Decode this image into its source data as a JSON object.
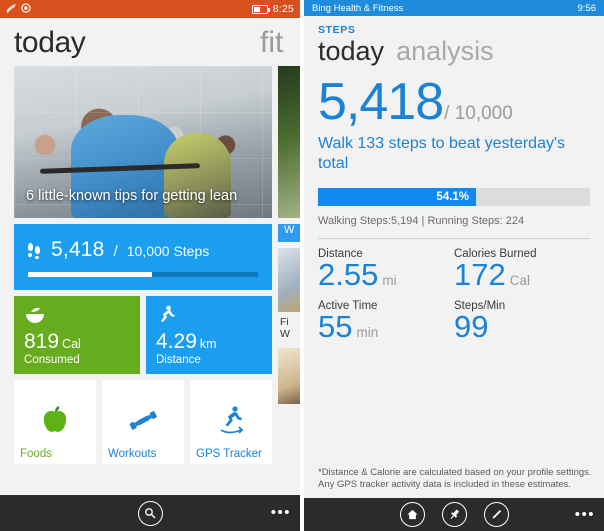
{
  "left_phone": {
    "status_bar": {
      "signal_icon": "wifi-icon",
      "record_icon": "record-icon",
      "battery_icon": "battery-icon",
      "time": "8:25",
      "background_color": "#d9501f"
    },
    "pivot": {
      "current": "today",
      "next": "fit"
    },
    "hero_tile": {
      "caption": "6 little-known tips for getting lean"
    },
    "steps_tile": {
      "icon": "footsteps-icon",
      "value": "5,418",
      "separator": "/",
      "goal": "10,000 Steps",
      "progress_percent": 54.1,
      "background_color": "#1b9df0"
    },
    "metric_tiles": [
      {
        "icon": "food-bowl-icon",
        "value": "819",
        "unit": "Cal",
        "label": "Consumed",
        "color": "#67ab1e"
      },
      {
        "icon": "runner-icon",
        "value": "4.29",
        "unit": "km",
        "label": "Distance",
        "color": "#1b9df0"
      }
    ],
    "quick_tiles": [
      {
        "icon": "apple-icon",
        "label": "Foods",
        "color": "#67ab1e"
      },
      {
        "icon": "dumbbell-icon",
        "label": "Workouts",
        "color": "#1b82d4"
      },
      {
        "icon": "gps-runner-icon",
        "label": "GPS Tracker",
        "color": "#1b82d4"
      }
    ],
    "side_column": {
      "badge": "W",
      "caption_line1": "Fi",
      "caption_line2": "W"
    },
    "app_bar": {
      "search_icon": "search-icon",
      "more_icon": "ellipsis-icon"
    }
  },
  "right_phone": {
    "status_bar": {
      "app_title": "Bing Health & Fitness",
      "time": "9:56",
      "background_color": "#1f8bdb"
    },
    "kicker": "STEPS",
    "pivot": {
      "current": "today",
      "next": "analysis"
    },
    "hero": {
      "steps": "5,418",
      "goal": "/ 10,000",
      "message": "Walk 133 steps to beat yesterday's total"
    },
    "progress": {
      "label": "54.1%",
      "percent": 54.1,
      "fill_color": "#1289f0",
      "track_color": "#dcdcdc"
    },
    "split": "Walking Steps:5,194  |  Running Steps: 224",
    "metrics": [
      {
        "label": "Distance",
        "value": "2.55",
        "unit": "mi"
      },
      {
        "label": "Calories Burned",
        "value": "172",
        "unit": "Cal"
      },
      {
        "label": "Active Time",
        "value": "55",
        "unit": "min"
      },
      {
        "label": "Steps/Min",
        "value": "99",
        "unit": ""
      }
    ],
    "footnote_line1": "*Distance & Calorie are calculated based on your profile settings.",
    "footnote_line2": "Any GPS tracker activity data is included in these estimates.",
    "app_bar": {
      "home_icon": "home-icon",
      "pin_icon": "pin-icon",
      "edit_icon": "pencil-icon",
      "more_icon": "ellipsis-icon"
    }
  }
}
